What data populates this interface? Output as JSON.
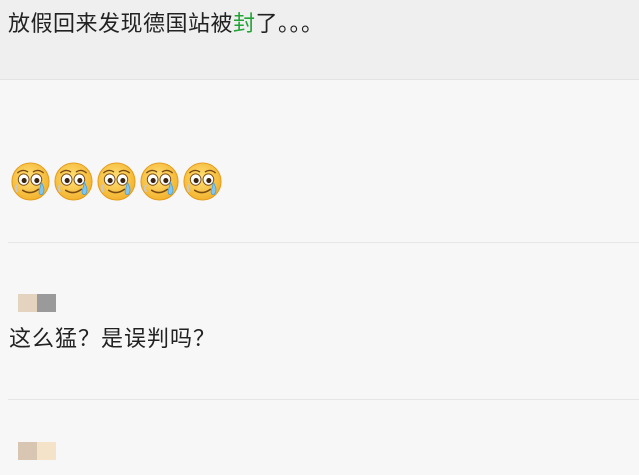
{
  "post": {
    "title_part1": "放假回来发现德国站被",
    "title_highlight": "封",
    "title_part2": "了。。。",
    "highlight_color": "#21a336",
    "emojis": [
      "crying-smile-emoji",
      "crying-smile-emoji",
      "crying-smile-emoji",
      "crying-smile-emoji",
      "crying-smile-emoji"
    ]
  },
  "comments": [
    {
      "avatar_colors": [
        "#e4d3bf",
        "#9a9a9a"
      ],
      "text": "这么猛？是误判吗？"
    },
    {
      "avatar_colors": [
        "#d9c6b2",
        "#f5e3c9"
      ]
    }
  ]
}
